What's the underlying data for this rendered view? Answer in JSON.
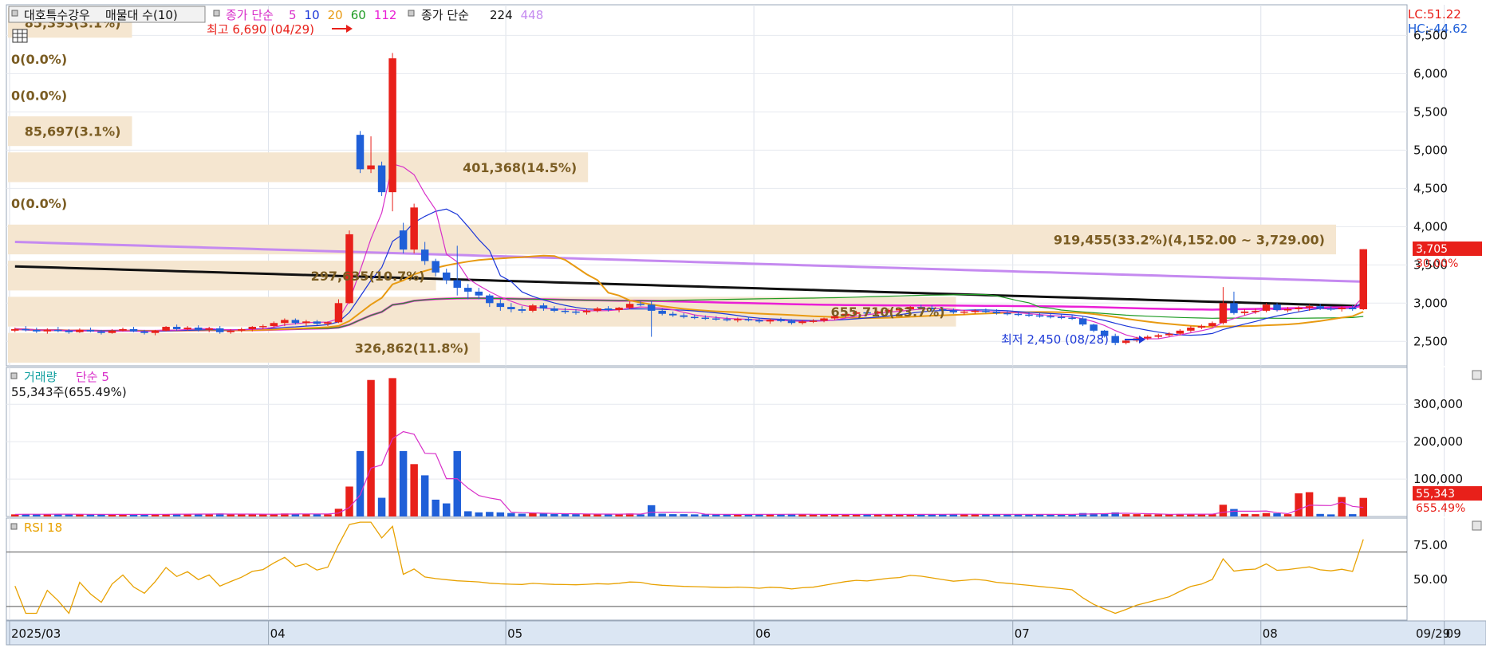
{
  "header": {
    "stock_name": "대호특수강우",
    "volume_profile": "매물대 수(10)",
    "ma_prefix": "종가 단순",
    "ma_periods": [
      {
        "label": "5",
        "color": "#d82fc9"
      },
      {
        "label": "10",
        "color": "#1b36d8"
      },
      {
        "label": "20",
        "color": "#e89a12"
      },
      {
        "label": "60",
        "color": "#1f9b24"
      },
      {
        "label": "112",
        "color": "#ea1fd6"
      }
    ],
    "ma2_prefix": "종가 단순",
    "ma2_periods": [
      {
        "label": "224",
        "color": "#111111"
      },
      {
        "label": "448",
        "color": "#c58af0"
      }
    ]
  },
  "right_labels": {
    "lc": "LC:51.22",
    "hc": "HC:-44.62"
  },
  "annotations": {
    "high": "최고 6,690 (04/29)",
    "low": "최저 2,450 (08/28)"
  },
  "volume_header": {
    "title": "거래량",
    "ma_label": "단순 5",
    "last": "55,343주(655.49%)"
  },
  "rsi_header": {
    "title": "RSI 18"
  },
  "price_tag": {
    "value": "3,705",
    "pct": "30.00%"
  },
  "volume_tag": {
    "value": "55,343",
    "pct": "655.49%"
  },
  "x_axis": {
    "labels": [
      "2025/03",
      "04",
      "05",
      "06",
      "07",
      "08",
      "09"
    ],
    "last_date": "09/29"
  },
  "colors": {
    "up": "#e8201a",
    "down": "#1f5fd8",
    "rsi": "#e8a100",
    "band": "#f5e6d0"
  },
  "chart_data": [
    {
      "type": "candlestick",
      "title": "대호특수강우",
      "y_ticks": [
        2500,
        3000,
        3500,
        4000,
        4500,
        5000,
        5500,
        6000,
        6500
      ],
      "ylim": [
        2180,
        6900
      ],
      "grid": true,
      "volume_profile": [
        {
          "label": "85,393(3.1%)",
          "price": 6690,
          "weight": 3.1
        },
        {
          "label": "0(0.0%)",
          "price": 6270,
          "weight": 0
        },
        {
          "label": "0(0.0%)",
          "price": 5850,
          "weight": 0
        },
        {
          "label": "85,697(3.1%)",
          "price": 5420,
          "weight": 3.1
        },
        {
          "label": "401,368(14.5%)",
          "price": 4780,
          "weight": 14.5
        },
        {
          "label": "0(0.0%)",
          "price": 4360,
          "weight": 0
        },
        {
          "label": "919,455(33.2%)(4,152.00 ~ 3,729.00)",
          "price": 3940,
          "weight": 33.2
        },
        {
          "label": "297,635(10.7%)",
          "price": 3520,
          "weight": 10.7
        },
        {
          "label": "655,710(23.7%)",
          "price": 3030,
          "weight": 23.7
        },
        {
          "label": "326,862(11.8%)",
          "price": 2620,
          "weight": 11.8
        }
      ],
      "candles": [
        [
          2640,
          2680,
          2620,
          2660
        ],
        [
          2660,
          2700,
          2630,
          2650
        ],
        [
          2650,
          2680,
          2610,
          2630
        ],
        [
          2630,
          2670,
          2600,
          2650
        ],
        [
          2650,
          2690,
          2620,
          2640
        ],
        [
          2640,
          2660,
          2600,
          2620
        ],
        [
          2620,
          2670,
          2610,
          2650
        ],
        [
          2650,
          2680,
          2620,
          2630
        ],
        [
          2630,
          2650,
          2590,
          2610
        ],
        [
          2610,
          2660,
          2600,
          2640
        ],
        [
          2640,
          2680,
          2630,
          2660
        ],
        [
          2660,
          2690,
          2620,
          2630
        ],
        [
          2630,
          2650,
          2590,
          2610
        ],
        [
          2610,
          2650,
          2580,
          2640
        ],
        [
          2640,
          2700,
          2630,
          2690
        ],
        [
          2690,
          2720,
          2640,
          2660
        ],
        [
          2660,
          2700,
          2640,
          2680
        ],
        [
          2680,
          2710,
          2630,
          2650
        ],
        [
          2650,
          2690,
          2620,
          2670
        ],
        [
          2670,
          2700,
          2600,
          2620
        ],
        [
          2620,
          2660,
          2600,
          2640
        ],
        [
          2640,
          2680,
          2620,
          2660
        ],
        [
          2660,
          2700,
          2630,
          2690
        ],
        [
          2690,
          2720,
          2660,
          2700
        ],
        [
          2700,
          2760,
          2680,
          2740
        ],
        [
          2740,
          2800,
          2700,
          2780
        ],
        [
          2780,
          2800,
          2720,
          2740
        ],
        [
          2740,
          2780,
          2700,
          2760
        ],
        [
          2760,
          2780,
          2710,
          2730
        ],
        [
          2730,
          2760,
          2700,
          2750
        ],
        [
          2750,
          3050,
          2740,
          3000
        ],
        [
          3000,
          3950,
          2990,
          3900
        ],
        [
          5200,
          5250,
          4700,
          4750
        ],
        [
          4750,
          5180,
          4700,
          4800
        ],
        [
          4800,
          4850,
          4400,
          4450
        ],
        [
          4450,
          6270,
          4200,
          6200
        ],
        [
          3950,
          4050,
          3650,
          3700
        ],
        [
          3700,
          4300,
          3650,
          4250
        ],
        [
          3700,
          3800,
          3500,
          3550
        ],
        [
          3550,
          3580,
          3350,
          3400
        ],
        [
          3400,
          3450,
          3250,
          3300
        ],
        [
          3300,
          3750,
          3100,
          3200
        ],
        [
          3200,
          3250,
          3050,
          3150
        ],
        [
          3150,
          3200,
          3050,
          3100
        ],
        [
          3100,
          3120,
          2950,
          3000
        ],
        [
          3000,
          3050,
          2900,
          2950
        ],
        [
          2950,
          3000,
          2880,
          2920
        ],
        [
          2920,
          2960,
          2870,
          2900
        ],
        [
          2900,
          2990,
          2880,
          2970
        ],
        [
          2970,
          3000,
          2900,
          2930
        ],
        [
          2930,
          2960,
          2880,
          2900
        ],
        [
          2900,
          2940,
          2860,
          2890
        ],
        [
          2890,
          2920,
          2850,
          2880
        ],
        [
          2880,
          2920,
          2850,
          2900
        ],
        [
          2900,
          2950,
          2880,
          2930
        ],
        [
          2930,
          2960,
          2890,
          2910
        ],
        [
          2910,
          2950,
          2880,
          2940
        ],
        [
          2940,
          3020,
          2920,
          2990
        ],
        [
          2990,
          3020,
          2960,
          2980
        ],
        [
          2980,
          3030,
          2560,
          2900
        ],
        [
          2900,
          2930,
          2840,
          2860
        ],
        [
          2860,
          2890,
          2820,
          2840
        ],
        [
          2840,
          2870,
          2800,
          2820
        ],
        [
          2820,
          2850,
          2790,
          2810
        ],
        [
          2810,
          2840,
          2780,
          2800
        ],
        [
          2800,
          2830,
          2770,
          2790
        ],
        [
          2790,
          2820,
          2760,
          2780
        ],
        [
          2780,
          2810,
          2750,
          2790
        ],
        [
          2790,
          2820,
          2760,
          2780
        ],
        [
          2780,
          2810,
          2740,
          2760
        ],
        [
          2760,
          2800,
          2730,
          2780
        ],
        [
          2780,
          2810,
          2750,
          2770
        ],
        [
          2770,
          2790,
          2720,
          2740
        ],
        [
          2740,
          2780,
          2720,
          2760
        ],
        [
          2760,
          2790,
          2740,
          2770
        ],
        [
          2770,
          2810,
          2750,
          2800
        ],
        [
          2800,
          2840,
          2780,
          2830
        ],
        [
          2830,
          2880,
          2810,
          2860
        ],
        [
          2860,
          2900,
          2840,
          2880
        ],
        [
          2880,
          2910,
          2850,
          2870
        ],
        [
          2870,
          2900,
          2840,
          2890
        ],
        [
          2890,
          2930,
          2870,
          2910
        ],
        [
          2910,
          2940,
          2880,
          2920
        ],
        [
          2920,
          2960,
          2900,
          2950
        ],
        [
          2950,
          2980,
          2920,
          2940
        ],
        [
          2940,
          2970,
          2900,
          2920
        ],
        [
          2920,
          2950,
          2880,
          2900
        ],
        [
          2900,
          2930,
          2860,
          2880
        ],
        [
          2880,
          2910,
          2850,
          2890
        ],
        [
          2890,
          2920,
          2860,
          2900
        ],
        [
          2900,
          2930,
          2870,
          2890
        ],
        [
          2890,
          2920,
          2850,
          2870
        ],
        [
          2870,
          2900,
          2840,
          2860
        ],
        [
          2860,
          2890,
          2830,
          2850
        ],
        [
          2850,
          2880,
          2820,
          2840
        ],
        [
          2840,
          2870,
          2810,
          2830
        ],
        [
          2830,
          2860,
          2800,
          2820
        ],
        [
          2820,
          2850,
          2790,
          2810
        ],
        [
          2810,
          2840,
          2780,
          2800
        ],
        [
          2800,
          2820,
          2700,
          2720
        ],
        [
          2720,
          2730,
          2620,
          2640
        ],
        [
          2640,
          2650,
          2550,
          2570
        ],
        [
          2570,
          2600,
          2450,
          2480
        ],
        [
          2480,
          2530,
          2460,
          2510
        ],
        [
          2510,
          2560,
          2490,
          2540
        ],
        [
          2540,
          2580,
          2520,
          2560
        ],
        [
          2560,
          2600,
          2540,
          2580
        ],
        [
          2580,
          2620,
          2560,
          2600
        ],
        [
          2600,
          2660,
          2580,
          2640
        ],
        [
          2640,
          2700,
          2620,
          2680
        ],
        [
          2680,
          2720,
          2660,
          2700
        ],
        [
          2700,
          2760,
          2690,
          2740
        ],
        [
          2740,
          3210,
          2720,
          3000
        ],
        [
          3000,
          3150,
          2850,
          2870
        ],
        [
          2870,
          2920,
          2840,
          2890
        ],
        [
          2890,
          2930,
          2860,
          2900
        ],
        [
          2900,
          3000,
          2880,
          2980
        ],
        [
          2980,
          3000,
          2890,
          2910
        ],
        [
          2910,
          2950,
          2880,
          2920
        ],
        [
          2920,
          2960,
          2890,
          2940
        ],
        [
          2940,
          2980,
          2900,
          2960
        ],
        [
          2960,
          2990,
          2910,
          2930
        ],
        [
          2930,
          2960,
          2900,
          2920
        ],
        [
          2920,
          2960,
          2890,
          2940
        ],
        [
          2940,
          2970,
          2900,
          2920
        ],
        [
          2920,
          3705,
          2910,
          3705
        ]
      ]
    },
    {
      "type": "bar",
      "title": "거래량",
      "y_ticks": [
        100000,
        200000,
        300000
      ],
      "ylim": [
        0,
        390000
      ],
      "series": [
        {
          "name": "단순 5"
        }
      ]
    },
    {
      "type": "line",
      "title": "RSI 18",
      "y_ticks": [
        50,
        75
      ],
      "ylim": [
        20,
        95
      ],
      "reference_lines": [
        30,
        70
      ]
    }
  ]
}
